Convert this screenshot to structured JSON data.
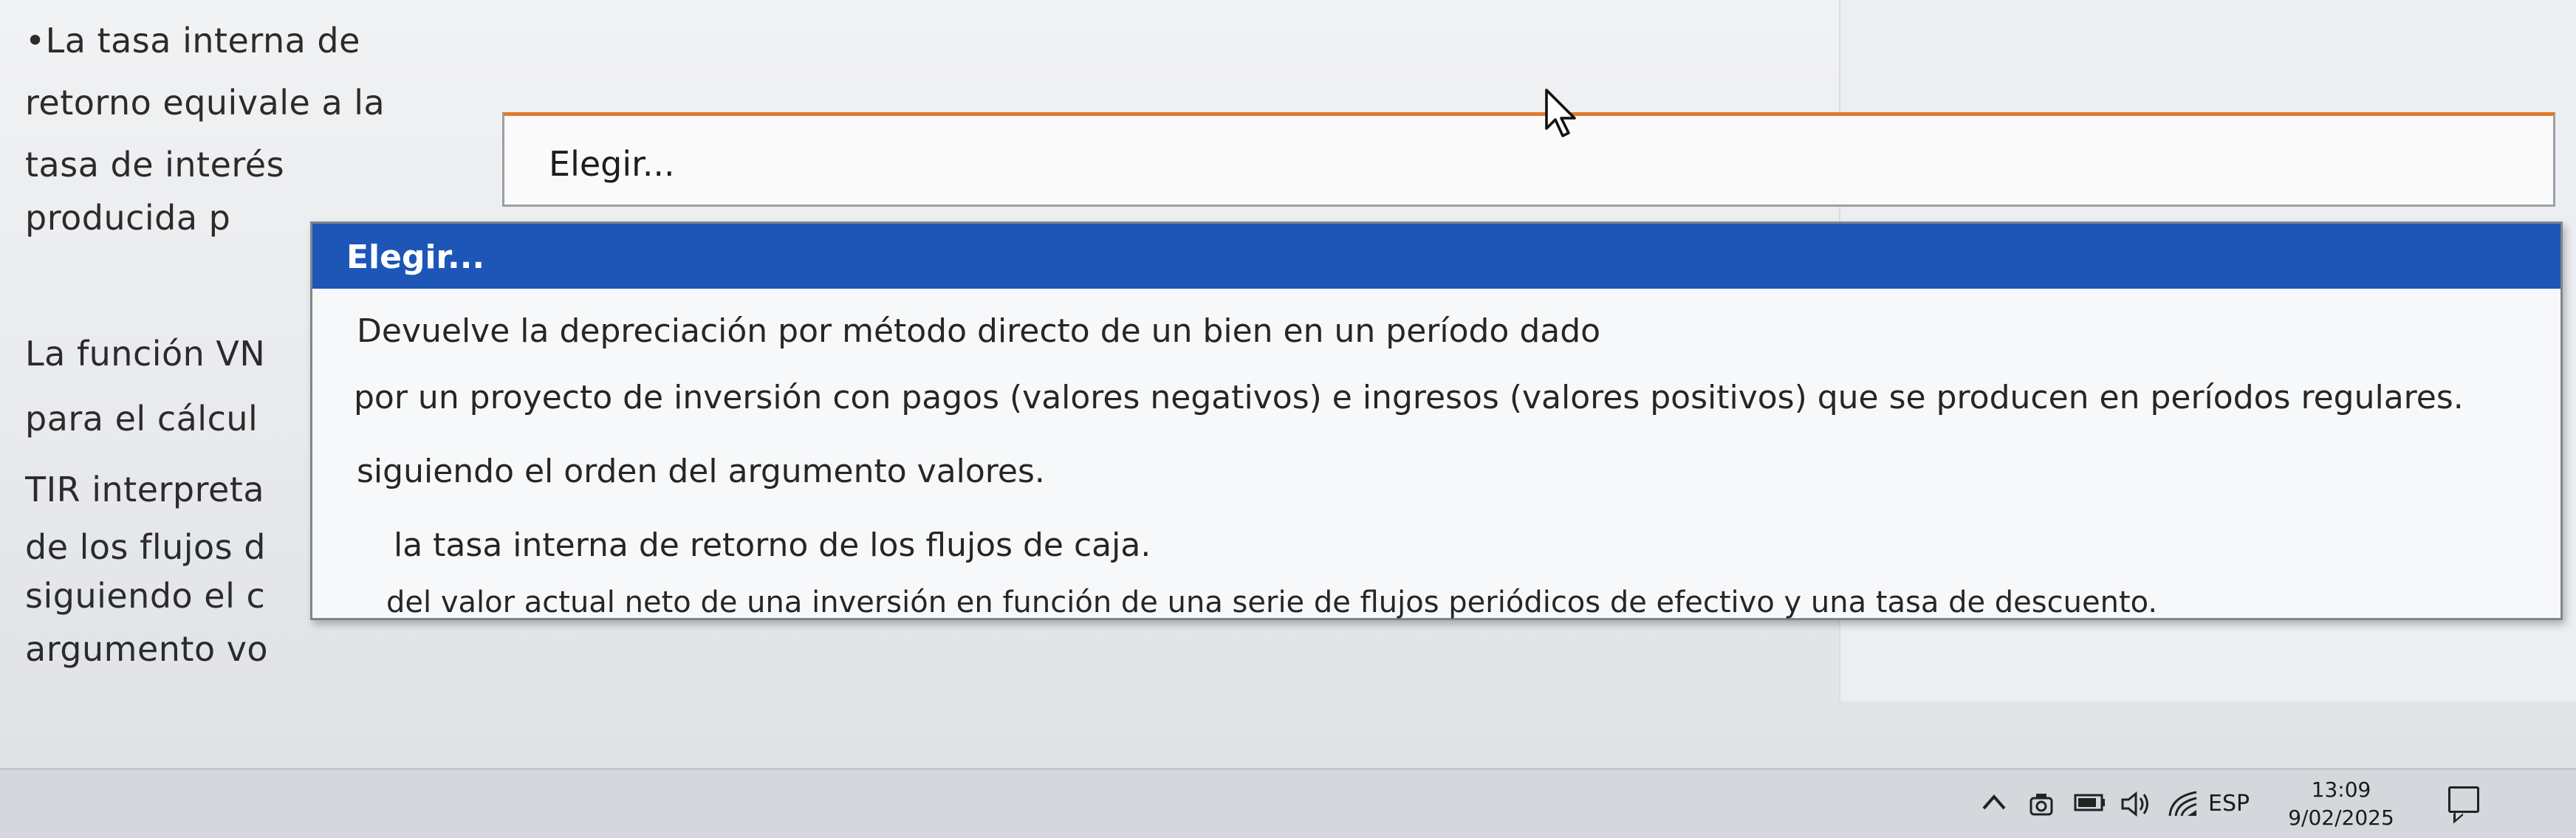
{
  "question": {
    "lines": [
      "•La tasa interna de",
      "retorno equivale a la",
      "tasa de interés",
      "producida p",
      "La función VN",
      "para el cálcul",
      "TIR interpreta",
      "de los flujos d",
      "siguiendo el c",
      "argumento vo"
    ]
  },
  "select": {
    "value": "Elegir...",
    "options": [
      "Elegir...",
      "Devuelve la depreciación por método directo de un bien en un período dado",
      "por un proyecto de inversión con pagos (valores negativos) e ingresos (valores positivos) que se producen en períodos regulares.",
      "siguiendo el orden del argumento valores.",
      "la tasa interna de retorno de los flujos de caja.",
      "del valor actual neto de una inversión en función de una serie de flujos periódicos de efectivo y una tasa de descuento."
    ],
    "selected_index": 0
  },
  "taskbar": {
    "language": "ESP",
    "time": "13:09",
    "date": "9/02/2025",
    "icons": [
      "chevron-up-icon",
      "camera-icon",
      "battery-icon",
      "speaker-icon",
      "wifi-icon",
      "notification-icon"
    ]
  },
  "colors": {
    "selected_bg": "#1e56b8",
    "select_accent": "#e07a2e"
  }
}
